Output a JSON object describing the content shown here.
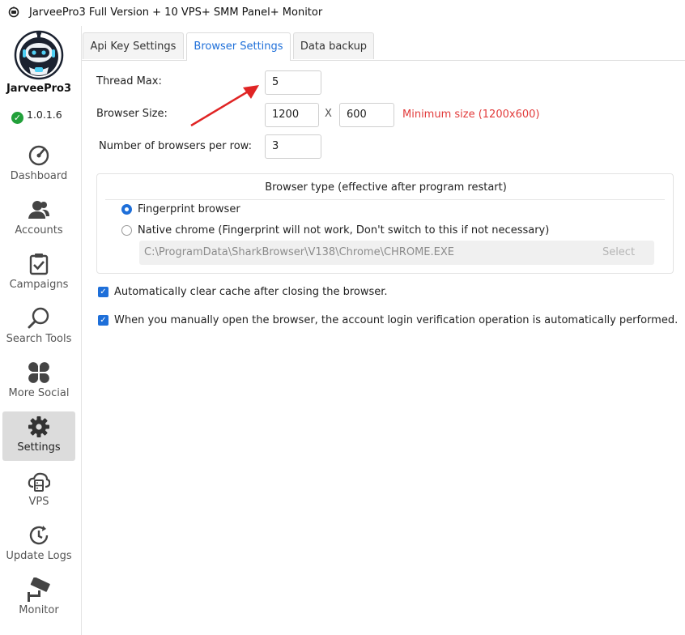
{
  "window": {
    "title": "JarveePro3 Full Version + 10 VPS+ SMM Panel+ Monitor"
  },
  "sidebar": {
    "app_name": "JarveePro3",
    "version": "1.0.1.6",
    "items": [
      {
        "label": "Dashboard",
        "icon": "dashboard-icon"
      },
      {
        "label": "Accounts",
        "icon": "accounts-icon"
      },
      {
        "label": "Campaigns",
        "icon": "campaigns-icon"
      },
      {
        "label": "Search Tools",
        "icon": "search-icon"
      },
      {
        "label": "More Social",
        "icon": "more-social-icon"
      },
      {
        "label": "Settings",
        "icon": "gear-icon",
        "active": true
      },
      {
        "label": "VPS",
        "icon": "cloud-server-icon"
      },
      {
        "label": "Update Logs",
        "icon": "clock-refresh-icon"
      },
      {
        "label": "Monitor",
        "icon": "camera-icon"
      }
    ]
  },
  "tabs": [
    {
      "label": "Api Key Settings"
    },
    {
      "label": "Browser Settings",
      "active": true
    },
    {
      "label": "Data backup"
    }
  ],
  "form": {
    "thread_max_label": "Thread Max:",
    "thread_max_value": "5",
    "browser_size_label": "Browser Size:",
    "width_value": "1200",
    "separator": "X",
    "height_value": "600",
    "size_hint": "Minimum size (1200x600)",
    "per_row_label": "Number of browsers per row:",
    "per_row_value": "3"
  },
  "browser_type": {
    "title": "Browser type (effective after program restart)",
    "option_fingerprint": "Fingerprint browser",
    "option_native": "Native chrome (Fingerprint will not work,  Don't switch to this if not necessary)",
    "selected": "fingerprint",
    "chrome_path": "C:\\ProgramData\\SharkBrowser\\V138\\Chrome\\CHROME.EXE",
    "select_label": "Select"
  },
  "options": {
    "clear_cache": "Automatically clear cache after closing the browser.",
    "login_verification": "When you manually open the browser, the account login verification operation is automatically performed."
  },
  "colors": {
    "accent": "#1e6fd9",
    "warning": "#e23b3b",
    "annotation_arrow": "#e02424",
    "check_green": "#22a03a"
  }
}
